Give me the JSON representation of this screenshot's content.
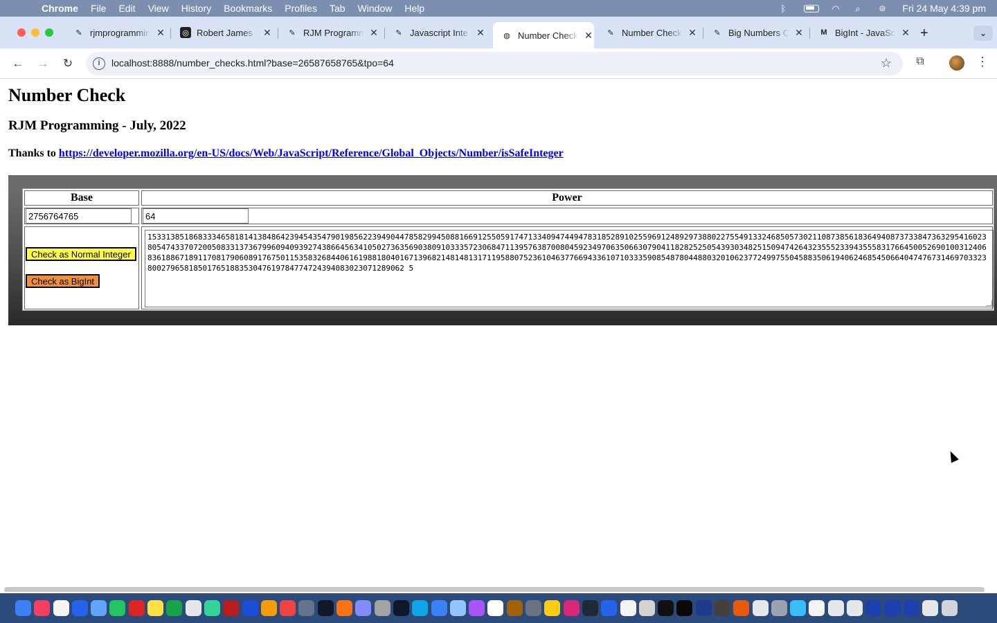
{
  "menubar": {
    "app": "Chrome",
    "items": [
      "File",
      "Edit",
      "View",
      "History",
      "Bookmarks",
      "Profiles",
      "Tab",
      "Window",
      "Help"
    ],
    "clock": "Fri 24 May  4:39 pm"
  },
  "tabs": [
    {
      "title": "rjmprogramming",
      "icon": "feather-icon",
      "active": false
    },
    {
      "title": "Robert James",
      "icon": "app-icon",
      "active": false
    },
    {
      "title": "RJM Programming",
      "icon": "feather-icon",
      "active": false
    },
    {
      "title": "Javascript Inte",
      "icon": "feather-icon",
      "active": false
    },
    {
      "title": "Number Check",
      "icon": "globe-icon",
      "active": true
    },
    {
      "title": "Number Check",
      "icon": "feather-icon",
      "active": false
    },
    {
      "title": "Big Numbers C",
      "icon": "feather-icon",
      "active": false
    },
    {
      "title": "BigInt - JavaSc",
      "icon": "mdn-icon",
      "active": false
    }
  ],
  "address": {
    "url": "localhost:8888/number_checks.html?base=26587658765&tpo=64"
  },
  "page": {
    "title": "Number Check",
    "subtitle": "RJM Programming - July, 2022",
    "thanks_label": "Thanks to",
    "thanks_link": "https://developer.mozilla.org/en-US/docs/Web/JavaScript/Reference/Global_Objects/Number/isSafeInteger",
    "table": {
      "base_header": "Base",
      "power_header": "Power",
      "base_value": "2756764765",
      "power_value": "64",
      "normal_button": "Check as Normal Integer",
      "bigint_button": "Check as BigInt",
      "result": "15331385186833346581814138486423945435479019856223949044785829945088166912550591747133409474494783185289102559691248929738802275549133246850573021108738561836494087373384736329541602380547433707200508331373679960940939274386645634105027363569038091033357230684711395763870080459234970635066307904118282525054393034825150947426432355523394355583176645005269010031240683618867189117081790608917675011535832684406161988180401671396821481481317119588075236104637766943361071033359085487804488032010623772499755045883506194062468545066404747673146970332380027965818501765188353047619784774724394083023071289062 5"
    }
  },
  "dock_icons": [
    "finder-icon",
    "music-icon",
    "notes-icon",
    "safari-icon",
    "mail-icon",
    "messages-icon",
    "opera-icon",
    "notes2-icon",
    "facetime-icon",
    "textedit-icon",
    "maps-icon",
    "filezilla-icon",
    "zoom-icon",
    "photos-icon",
    "news-icon",
    "xcode-icon",
    "terminal-icon",
    "firefox-icon",
    "bbedit-icon",
    "launchpad-icon",
    "appletv-icon",
    "appstore-icon",
    "pages-icon",
    "preview-icon",
    "podcasts-icon",
    "calendar-icon",
    "keychain-icon",
    "calculator-icon",
    "chrome-icon",
    "intellij-icon",
    "console-icon",
    "quicktime-icon",
    "file-icon",
    "settings-icon",
    "inkscape-icon",
    "terminal2-icon",
    "affinity-icon",
    "gimp-icon",
    "firefox2-icon",
    "script-icon",
    "system-icon",
    "folder-icon",
    "window1-icon",
    "window2-icon",
    "window3-icon",
    "download1-icon",
    "download2-icon",
    "download3-icon",
    "tray-icon",
    "trash-icon"
  ],
  "colors": {
    "menubar": "#7c8fb0",
    "tabstrip": "#d8e4f6",
    "dock": "#2c4a7a",
    "button_normal": "#ffff44",
    "button_bigint": "#f0913a"
  }
}
